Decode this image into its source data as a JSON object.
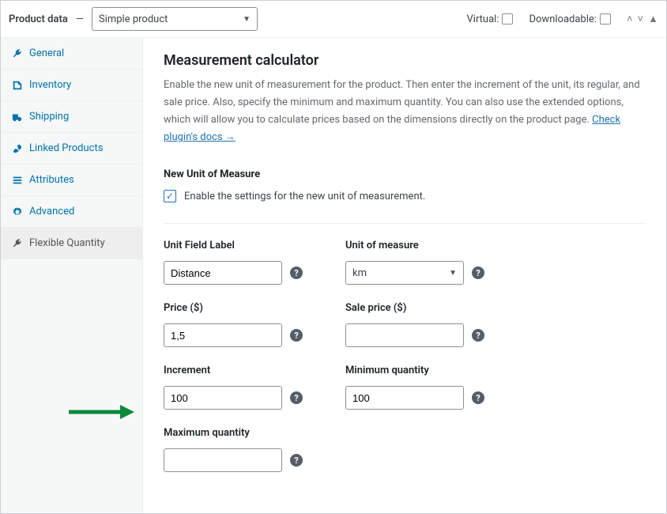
{
  "header": {
    "title": "Product data",
    "dash": "—",
    "product_type": "Simple product",
    "virtual_label": "Virtual:",
    "downloadable_label": "Downloadable:"
  },
  "sidebar": {
    "items": [
      {
        "label": "General"
      },
      {
        "label": "Inventory"
      },
      {
        "label": "Shipping"
      },
      {
        "label": "Linked Products"
      },
      {
        "label": "Attributes"
      },
      {
        "label": "Advanced"
      },
      {
        "label": "Flexible Quantity"
      }
    ]
  },
  "main": {
    "title": "Measurement calculator",
    "description_before_link": "Enable the new unit of measurement for the product. Then enter the increment of the unit, its regular, and sale price. Also, specify the minimum and maximum quantity. You can also use the extended options, which will allow you to calculate prices based on the dimensions directly on the product page. ",
    "docs_link_text": "Check plugin's docs →",
    "new_unit_heading": "New Unit of Measure",
    "enable_label": "Enable the settings for the new unit of measurement.",
    "fields": {
      "unit_field_label": {
        "label": "Unit Field Label",
        "value": "Distance"
      },
      "unit_of_measure": {
        "label": "Unit of measure",
        "value": "km"
      },
      "price": {
        "label": "Price ($)",
        "value": "1,5"
      },
      "sale_price": {
        "label": "Sale price ($)",
        "value": ""
      },
      "increment": {
        "label": "Increment",
        "value": "100"
      },
      "minimum_qty": {
        "label": "Minimum quantity",
        "value": "100"
      },
      "maximum_qty": {
        "label": "Maximum quantity",
        "value": ""
      }
    }
  }
}
